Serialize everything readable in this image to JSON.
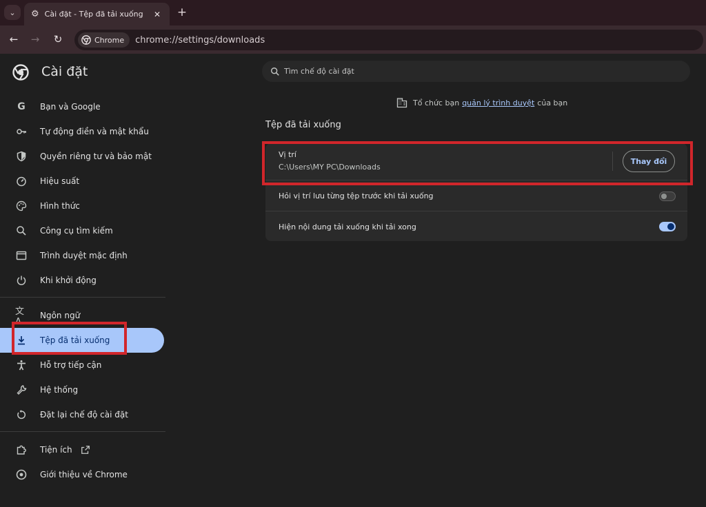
{
  "browser": {
    "tab_title": "Cài đặt - Tệp đã tải xuống",
    "chip_label": "Chrome",
    "url": "chrome://settings/downloads"
  },
  "header": {
    "title": "Cài đặt",
    "search_placeholder": "Tìm chế độ cài đặt"
  },
  "sidebar": {
    "items": [
      {
        "label": "Bạn và Google",
        "icon": "google-icon"
      },
      {
        "label": "Tự động điền và mật khẩu",
        "icon": "key-icon"
      },
      {
        "label": "Quyền riêng tư và bảo mật",
        "icon": "shield-icon"
      },
      {
        "label": "Hiệu suất",
        "icon": "speedometer-icon"
      },
      {
        "label": "Hình thức",
        "icon": "palette-icon"
      },
      {
        "label": "Công cụ tìm kiếm",
        "icon": "search-icon"
      },
      {
        "label": "Trình duyệt mặc định",
        "icon": "browser-window-icon"
      },
      {
        "label": "Khi khởi động",
        "icon": "power-icon"
      },
      {
        "label": "Ngôn ngữ",
        "icon": "translate-icon"
      },
      {
        "label": "Tệp đã tải xuống",
        "icon": "download-icon"
      },
      {
        "label": "Hỗ trợ tiếp cận",
        "icon": "accessibility-icon"
      },
      {
        "label": "Hệ thống",
        "icon": "wrench-icon"
      },
      {
        "label": "Đặt lại chế độ cài đặt",
        "icon": "reset-icon"
      },
      {
        "label": "Tiện ích",
        "icon": "puzzle-icon"
      },
      {
        "label": "Giới thiệu về Chrome",
        "icon": "chrome-icon"
      }
    ],
    "active_index": 9
  },
  "main": {
    "managed_prefix": "Tổ chức bạn",
    "managed_link": "quản lý trình duyệt",
    "managed_suffix": "của bạn",
    "section_title": "Tệp đã tải xuống",
    "location_label": "Vị trí",
    "location_value": "C:\\Users\\MY PC\\Downloads",
    "change_button": "Thay đổi",
    "ask_label": "Hỏi vị trí lưu từng tệp trước khi tải xuống",
    "ask_enabled": false,
    "show_label": "Hiện nội dung tải xuống khi tải xong",
    "show_enabled": true
  },
  "colors": {
    "accent": "#a8c7fa",
    "annotation_red": "#d1262b"
  }
}
